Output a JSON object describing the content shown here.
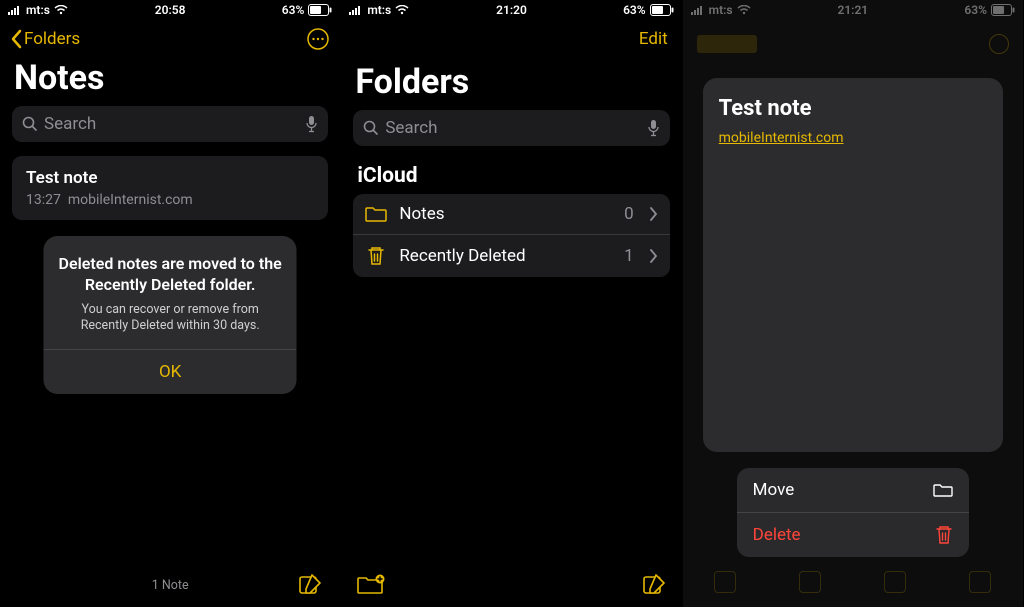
{
  "screen1": {
    "status": {
      "carrier": "mt:s",
      "time": "20:58",
      "battery": "63%"
    },
    "back_label": "Folders",
    "title": "Notes",
    "search_placeholder": "Search",
    "note": {
      "title": "Test note",
      "time": "13:27",
      "preview": "mobileInternist.com"
    },
    "alert": {
      "headline": "Deleted notes are moved to the Recently Deleted folder.",
      "body": "You can recover or remove from Recently Deleted within 30 days.",
      "ok": "OK"
    },
    "footer_count": "1 Note"
  },
  "screen2": {
    "status": {
      "carrier": "mt:s",
      "time": "21:20",
      "battery": "63%"
    },
    "edit_label": "Edit",
    "title": "Folders",
    "search_placeholder": "Search",
    "section": "iCloud",
    "folders": [
      {
        "icon": "folder",
        "label": "Notes",
        "count": "0"
      },
      {
        "icon": "trash",
        "label": "Recently Deleted",
        "count": "1"
      }
    ]
  },
  "screen3": {
    "status": {
      "carrier": "mt:s",
      "time": "21:21",
      "battery": "63%"
    },
    "note": {
      "title": "Test note",
      "link": "mobileInternist.com"
    },
    "menu": {
      "move_label": "Move",
      "delete_label": "Delete"
    }
  }
}
